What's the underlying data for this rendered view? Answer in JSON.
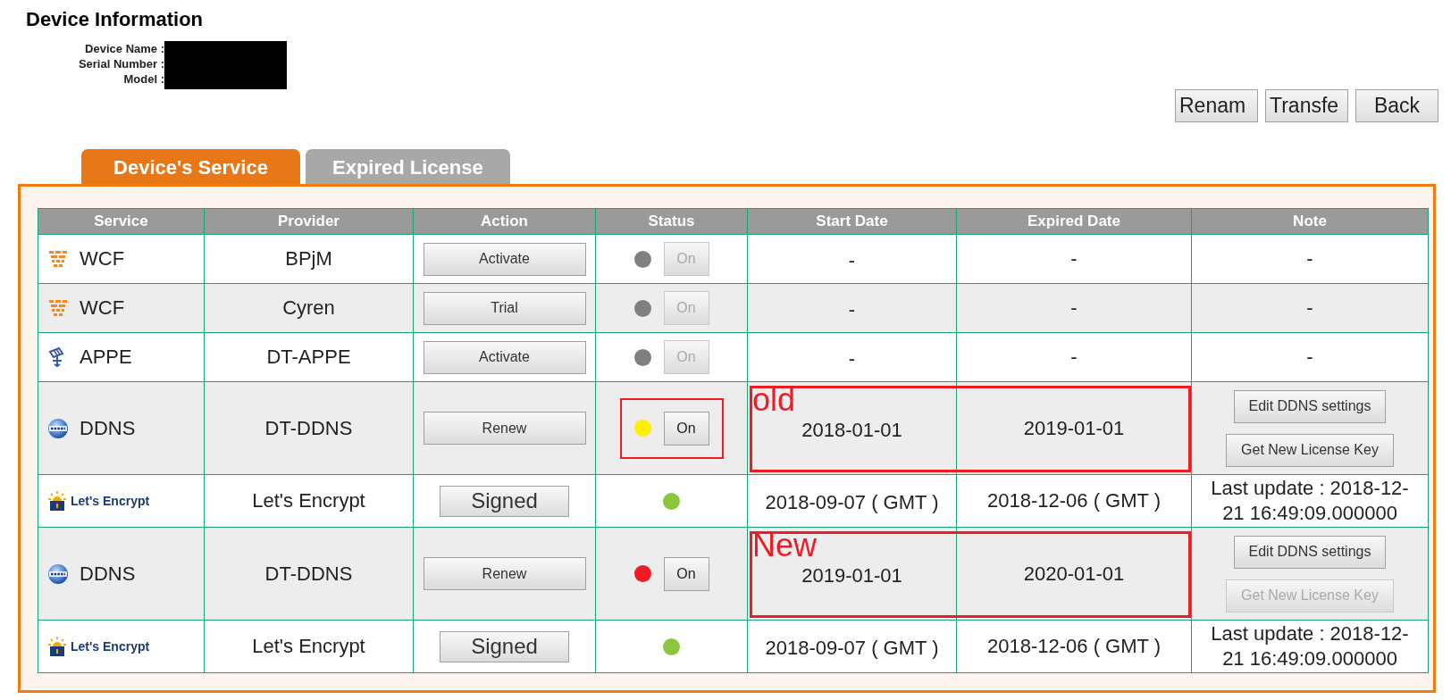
{
  "page": {
    "title": "Device Information"
  },
  "device_info": {
    "labels": [
      "Device Name :",
      "Serial Number :",
      "Model :"
    ]
  },
  "top_buttons": [
    "Renam",
    "Transfe",
    "Back"
  ],
  "tabs": [
    {
      "label": "Device's Service",
      "selected": true
    },
    {
      "label": "Expired License",
      "selected": false
    }
  ],
  "table": {
    "columns": [
      "Service",
      "Provider",
      "Action",
      "Status",
      "Start Date",
      "Expired Date",
      "Note"
    ],
    "rows": [
      {
        "kind": "wall",
        "service": "WCF",
        "provider": "BPjM",
        "action": {
          "label": "Activate",
          "kind": "normal"
        },
        "status": {
          "color": "#808080",
          "button": {
            "label": "On",
            "disabled": true
          },
          "marked": false
        },
        "start": "-",
        "expired": "-",
        "note": {
          "kind": "text",
          "text": "-"
        }
      },
      {
        "kind": "wall",
        "service": "WCF",
        "provider": "Cyren",
        "action": {
          "label": "Trial",
          "kind": "normal"
        },
        "status": {
          "color": "#808080",
          "button": {
            "label": "On",
            "disabled": true
          },
          "marked": false
        },
        "start": "-",
        "expired": "-",
        "note": {
          "kind": "text",
          "text": "-"
        }
      },
      {
        "kind": "dish",
        "service": "APPE",
        "provider": "DT-APPE",
        "action": {
          "label": "Activate",
          "kind": "normal"
        },
        "status": {
          "color": "#808080",
          "button": {
            "label": "On",
            "disabled": true
          },
          "marked": false
        },
        "start": "-",
        "expired": "-",
        "note": {
          "kind": "text",
          "text": "-"
        }
      },
      {
        "kind": "globe",
        "service": "DDNS",
        "provider": "DT-DDNS",
        "action": {
          "label": "Renew",
          "kind": "normal"
        },
        "status": {
          "color": "#ffee00",
          "button": {
            "label": "On",
            "disabled": false
          },
          "marked": true
        },
        "start": "2018-01-01",
        "expired": "2019-01-01",
        "annotation": "old",
        "note": {
          "kind": "buttons",
          "buttons": [
            {
              "label": "Edit DDNS settings",
              "disabled": false
            },
            {
              "label": "Get New License Key",
              "disabled": false
            }
          ]
        }
      },
      {
        "kind": "logo",
        "service": "Let's Encrypt",
        "provider": "Let's Encrypt",
        "action": {
          "label": "Signed",
          "kind": "large"
        },
        "status": {
          "color": "#8cc63f",
          "marked": false
        },
        "start": "2018-09-07 ( GMT )",
        "expired": "2018-12-06 ( GMT )",
        "note": {
          "kind": "text",
          "text": "Last update : 2018-12-21 16:49:09.000000"
        }
      },
      {
        "kind": "globe",
        "service": "DDNS",
        "provider": "DT-DDNS",
        "action": {
          "label": "Renew",
          "kind": "normal"
        },
        "status": {
          "color": "#ee1c24",
          "button": {
            "label": "On",
            "disabled": false
          },
          "marked": false
        },
        "start": "2019-01-01",
        "expired": "2020-01-01",
        "annotation": "New",
        "note": {
          "kind": "buttons",
          "buttons": [
            {
              "label": "Edit DDNS settings",
              "disabled": false
            },
            {
              "label": "Get New License Key",
              "disabled": true
            }
          ]
        }
      },
      {
        "kind": "logo",
        "service": "Let's Encrypt",
        "provider": "Let's Encrypt",
        "action": {
          "label": "Signed",
          "kind": "large"
        },
        "status": {
          "color": "#8cc63f",
          "marked": false
        },
        "start": "2018-09-07 ( GMT )",
        "expired": "2018-12-06 ( GMT )",
        "note": {
          "kind": "text",
          "text": "Last update : 2018-12-21 16:49:09.000000"
        }
      }
    ]
  }
}
